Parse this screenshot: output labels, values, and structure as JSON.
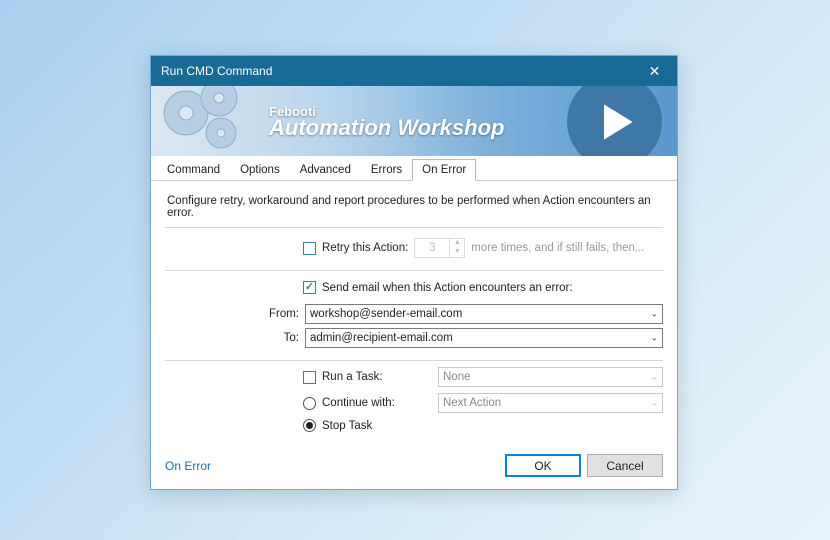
{
  "title": "Run CMD Command",
  "brand_small": "Febooti",
  "brand_big": "Automation Workshop",
  "tabs": [
    "Command",
    "Options",
    "Advanced",
    "Errors",
    "On Error"
  ],
  "active_tab": "On Error",
  "helptext": "Configure retry, workaround and report procedures to be performed when Action encounters an error.",
  "retry": {
    "label": "Retry this Action:",
    "checked": false,
    "value": "3",
    "hint": "more times, and if still fails, then..."
  },
  "email": {
    "label": "Send email when this Action encounters an error:",
    "checked": true,
    "from_label": "From:",
    "from_value": "workshop@sender-email.com",
    "to_label": "To:",
    "to_value": "admin@recipient-email.com"
  },
  "actions": {
    "run_task_label": "Run a Task:",
    "run_task_checked": false,
    "run_task_value": "None",
    "continue_label": "Continue with:",
    "continue_checked": false,
    "continue_value": "Next Action",
    "stop_label": "Stop Task",
    "stop_checked": true
  },
  "footer": {
    "link": "On Error",
    "ok": "OK",
    "cancel": "Cancel"
  }
}
